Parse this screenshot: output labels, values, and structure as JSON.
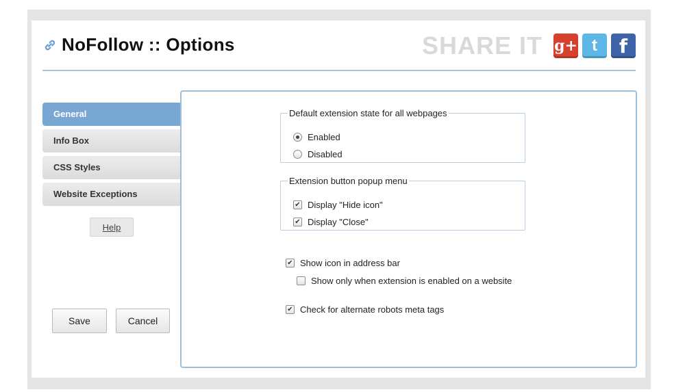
{
  "header": {
    "title": "NoFollow :: Options",
    "share_label": "SHARE IT",
    "social": {
      "gplus_glyph": "g+",
      "twitter_glyph": "t",
      "facebook_glyph": "f"
    }
  },
  "sidebar": {
    "items": [
      {
        "label": "General",
        "active": true
      },
      {
        "label": "Info Box",
        "active": false
      },
      {
        "label": "CSS Styles",
        "active": false
      },
      {
        "label": "Website Exceptions",
        "active": false
      }
    ],
    "help_label": "Help"
  },
  "actions": {
    "save_label": "Save",
    "cancel_label": "Cancel"
  },
  "options": {
    "default_state": {
      "legend": "Default extension state for all webpages",
      "enabled_label": "Enabled",
      "disabled_label": "Disabled",
      "selected": "Enabled"
    },
    "popup_menu": {
      "legend": "Extension button popup menu",
      "hide_icon_label": "Display \"Hide icon\"",
      "hide_icon_checked": true,
      "close_label": "Display \"Close\"",
      "close_checked": true
    },
    "show_icon_label": "Show icon in address bar",
    "show_icon_checked": true,
    "show_only_enabled_label": "Show only when extension is enabled on a website",
    "show_only_enabled_checked": false,
    "alt_robots_label": "Check for alternate robots meta tags",
    "alt_robots_checked": true
  },
  "colors": {
    "accent": "#79a7d4",
    "panel_border": "#9cc0dc",
    "header_rule": "#a6c4dc",
    "gplus": "#d8402e",
    "twitter": "#5cb6e6",
    "facebook": "#3e63a8"
  }
}
